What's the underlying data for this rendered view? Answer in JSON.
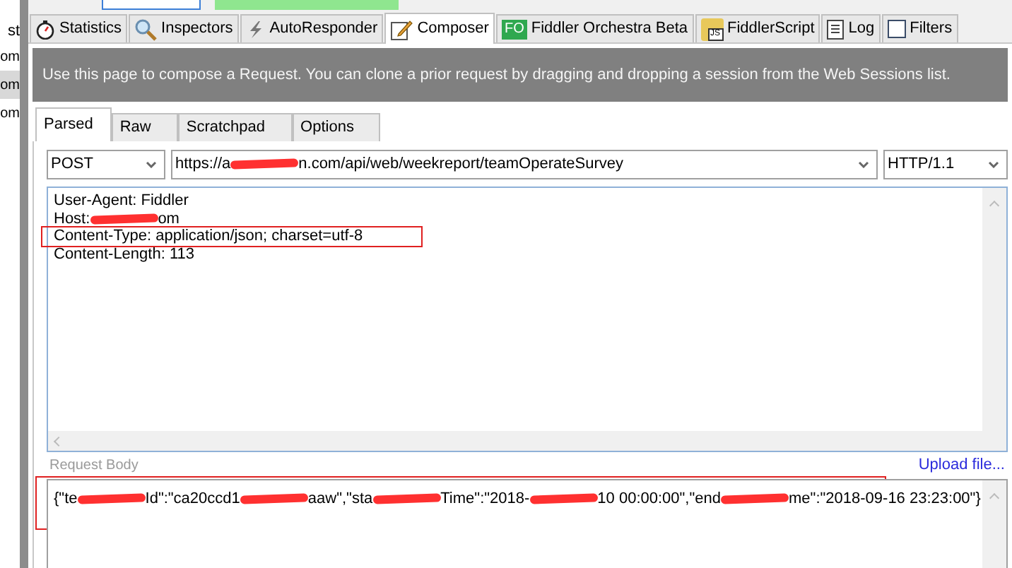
{
  "sessions_list": {
    "header": "st",
    "rows": [
      {
        "text": "om",
        "selected": false
      },
      {
        "text": "om",
        "selected": true
      },
      {
        "text": "om",
        "selected": false
      }
    ]
  },
  "tabs": [
    {
      "label": "Statistics",
      "selected": false
    },
    {
      "label": "Inspectors",
      "selected": false
    },
    {
      "label": "AutoResponder",
      "selected": false
    },
    {
      "label": "Composer",
      "selected": true
    },
    {
      "label": "Fiddler Orchestra Beta",
      "badge": "FO",
      "selected": false
    },
    {
      "label": "FiddlerScript",
      "badge": "JS",
      "selected": false
    },
    {
      "label": "Log",
      "selected": false
    },
    {
      "label": "Filters",
      "selected": false
    }
  ],
  "banner": "Use this page to compose a Request. You can clone a prior request by dragging and dropping a session from the Web Sessions list.",
  "subtabs": [
    {
      "label": "Parsed",
      "selected": true
    },
    {
      "label": "Raw",
      "selected": false
    },
    {
      "label": "Scratchpad",
      "selected": false
    },
    {
      "label": "Options",
      "selected": false
    }
  ],
  "method": "POST",
  "url": [
    {
      "kind": "text",
      "text": "https://a"
    },
    {
      "kind": "redacted"
    },
    {
      "kind": "text",
      "text": "n.com/api/web/weekreport/teamOperateSurvey"
    }
  ],
  "version": "HTTP/1.1",
  "headers": [
    {
      "parts": [
        {
          "kind": "text",
          "text": "User-Agent: Fiddler"
        }
      ],
      "highlighted": false
    },
    {
      "parts": [
        {
          "kind": "text",
          "text": "Host:"
        },
        {
          "kind": "redacted"
        },
        {
          "kind": "text",
          "text": "om"
        }
      ],
      "highlighted": false
    },
    {
      "parts": [
        {
          "kind": "text",
          "text": "Content-Type: application/json; charset=utf-8"
        }
      ],
      "highlighted": true
    },
    {
      "parts": [
        {
          "kind": "text",
          "text": "Content-Length: 113"
        }
      ],
      "highlighted": false
    }
  ],
  "request_body_label": "Request Body",
  "upload_link": "Upload file...",
  "body": {
    "highlighted": true,
    "parts": [
      {
        "kind": "text",
        "text": "{\"te"
      },
      {
        "kind": "redacted"
      },
      {
        "kind": "text",
        "text": "Id\":\"ca20ccd1"
      },
      {
        "kind": "redacted"
      },
      {
        "kind": "text",
        "text": "aaw\",\"sta"
      },
      {
        "kind": "redacted"
      },
      {
        "kind": "text",
        "text": "Time\":\"2018-"
      },
      {
        "kind": "redacted"
      },
      {
        "kind": "text",
        "text": "10 00:00:00\",\"end"
      },
      {
        "kind": "redacted"
      },
      {
        "kind": "text",
        "text": "me\":\"2018-09-16 23:23:00\"}"
      }
    ]
  }
}
